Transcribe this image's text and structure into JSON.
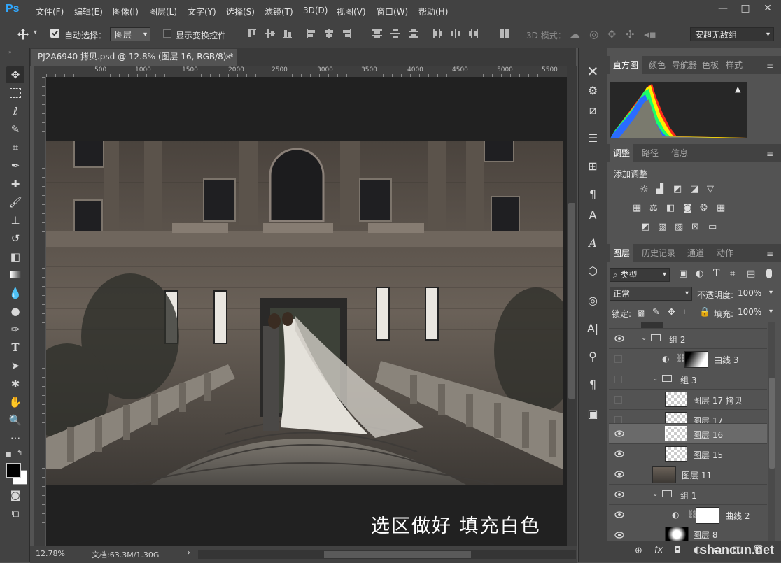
{
  "app": {
    "logo": "Ps"
  },
  "menu": [
    "文件(F)",
    "编辑(E)",
    "图像(I)",
    "图层(L)",
    "文字(Y)",
    "选择(S)",
    "滤镜(T)",
    "3D(D)",
    "视图(V)",
    "窗口(W)",
    "帮助(H)"
  ],
  "window_controls": [
    "—",
    "□",
    "✕"
  ],
  "options": {
    "auto_select_label": "自动选择：",
    "auto_select_value": "图层",
    "show_transform_label": "显示变换控件",
    "mode_3d_label": "3D 模式：",
    "workspace": "安超无敌组"
  },
  "document": {
    "tab_title": "PJ2A6940 拷贝.psd @ 12.8% (图层 16, RGB/8) *",
    "tab_close": "×",
    "ruler_ticks": [
      "500",
      "1000",
      "1500",
      "2000",
      "2500",
      "3000",
      "3500",
      "4000",
      "4500",
      "5000",
      "5500"
    ],
    "caption": "选区做好 填充白色",
    "zoom": "12.78%",
    "doc_size": "文档:63.3M/1.30G",
    "status_arrow": "›"
  },
  "panels": {
    "top_tabs": [
      "直方图",
      "颜色",
      "导航器",
      "色板",
      "样式"
    ],
    "mid_tabs": [
      "调整",
      "路径",
      "信息"
    ],
    "add_adjustment": "添加调整",
    "histogram_warning": "▲",
    "layer_tabs": [
      "图层",
      "历史记录",
      "通道",
      "动作"
    ],
    "filter_kind": "类型",
    "blend_mode": "正常",
    "opacity_label": "不透明度:",
    "opacity_value": "100%",
    "lock_label": "锁定:",
    "fill_label": "填充:",
    "fill_value": "100%"
  },
  "layers": [
    {
      "name": "组 2",
      "visible": true,
      "kind": "group"
    },
    {
      "name": "曲线 3",
      "visible": false,
      "kind": "curves"
    },
    {
      "name": "组 3",
      "visible": false,
      "kind": "group"
    },
    {
      "name": "图层 17 拷贝",
      "visible": false,
      "kind": "layer"
    },
    {
      "name": "图层 17",
      "visible": false,
      "kind": "layer"
    },
    {
      "name": "图层 16",
      "visible": true,
      "kind": "layer",
      "selected": true
    },
    {
      "name": "图层 15",
      "visible": true,
      "kind": "layer"
    },
    {
      "name": "图层 11",
      "visible": true,
      "kind": "photo"
    },
    {
      "name": "组 1",
      "visible": true,
      "kind": "group"
    },
    {
      "name": "曲线 2",
      "visible": true,
      "kind": "curves"
    },
    {
      "name": "图层 8",
      "visible": true,
      "kind": "layer"
    }
  ],
  "layer_footer": [
    "⊕",
    "fx",
    "◘",
    "◐",
    "▭",
    "□",
    "🗑"
  ],
  "watermark": "shancun.net",
  "colors": {
    "ps_blue": "#31a8ff",
    "panel_bg": "#535353",
    "chrome": "#424242"
  }
}
